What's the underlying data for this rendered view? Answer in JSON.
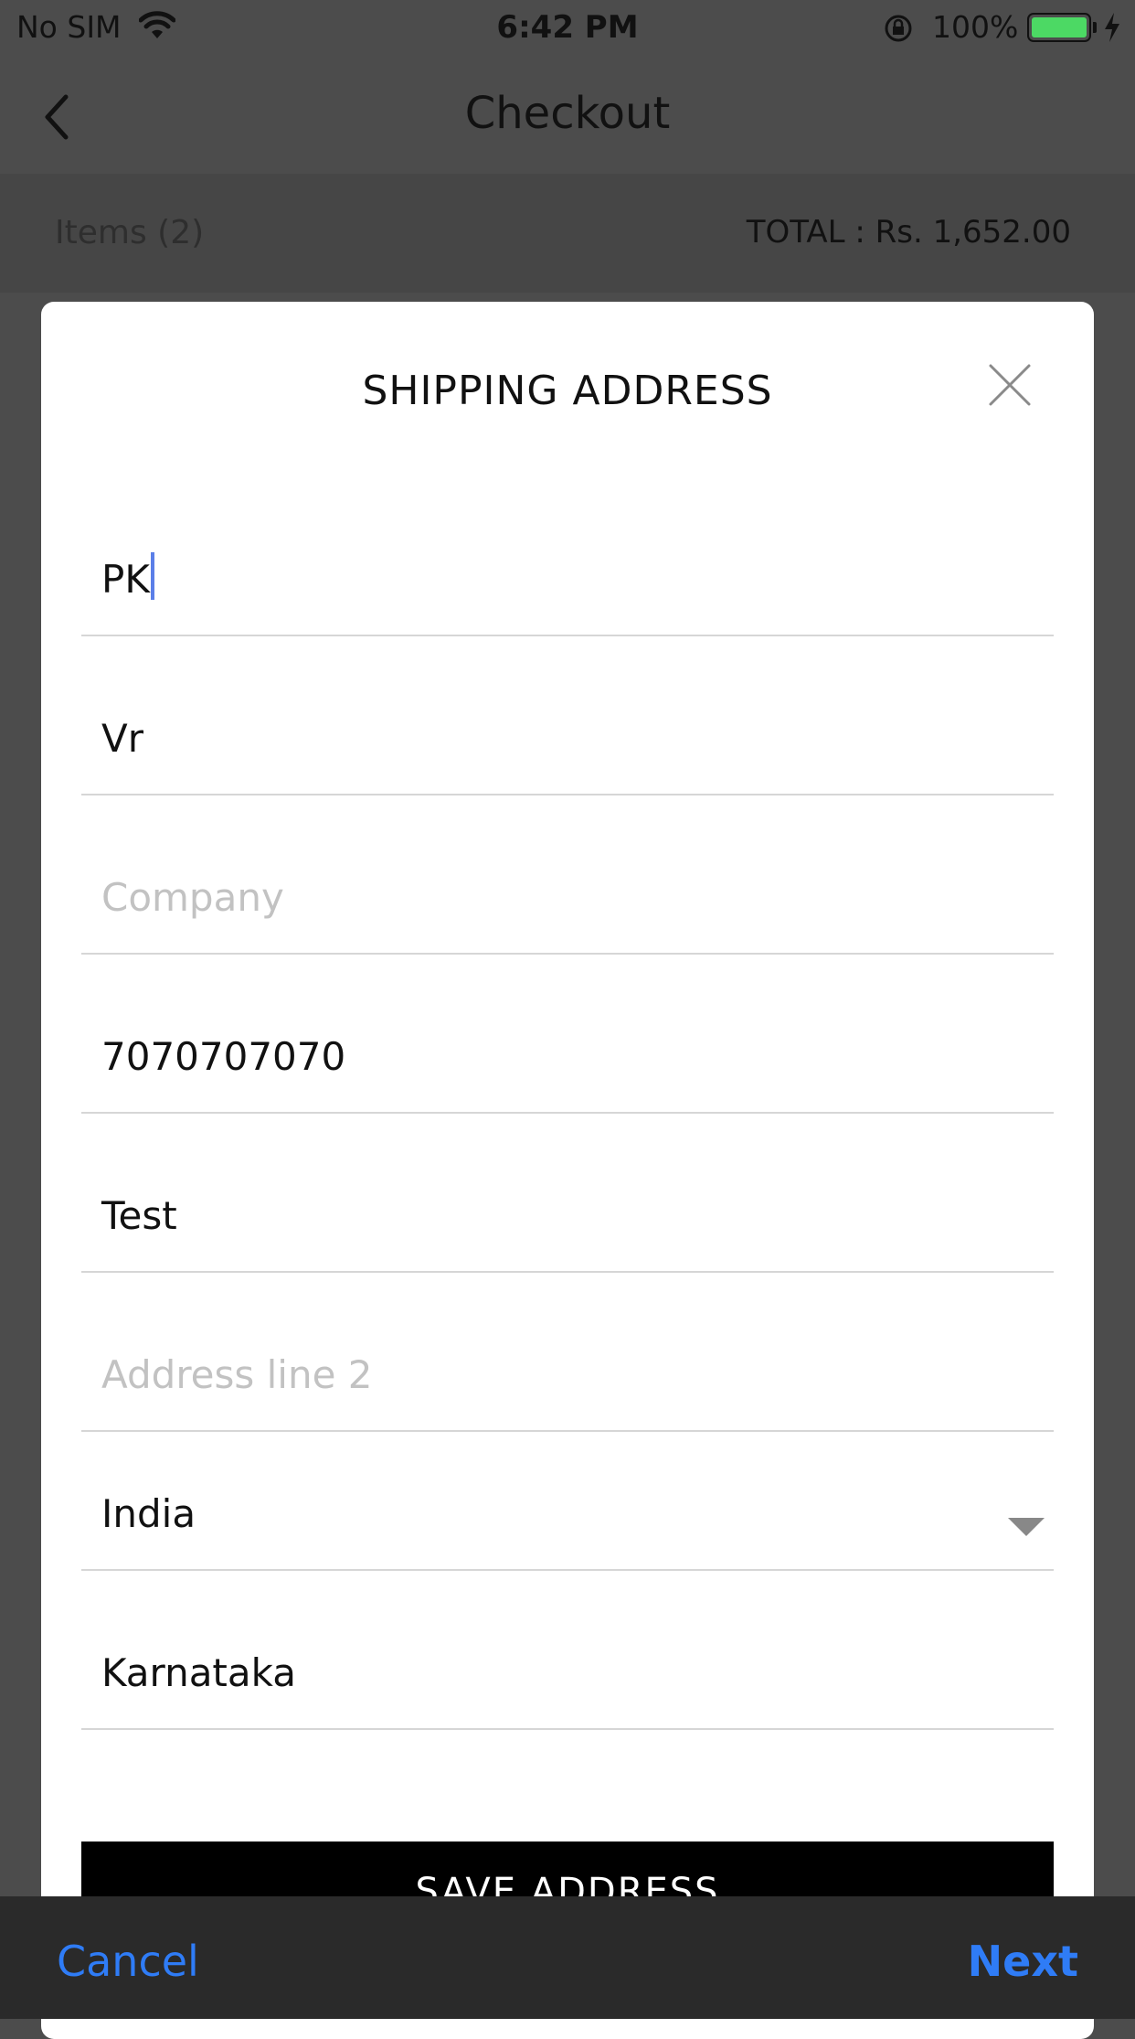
{
  "status_bar": {
    "carrier": "No SIM",
    "time": "6:42 PM",
    "battery_percent": "100%",
    "icons": [
      "wifi-icon",
      "rotation-lock-icon",
      "battery-icon",
      "charging-bolt-icon"
    ]
  },
  "nav": {
    "title": "Checkout",
    "back_icon": "chevron-left-icon"
  },
  "summary": {
    "items_label": "Items (2)",
    "total_label": "TOTAL : Rs. 1,652.00"
  },
  "modal": {
    "title": "SHIPPING ADDRESS",
    "close_icon": "close-icon",
    "fields": {
      "first_name": {
        "value": "PK"
      },
      "last_name": {
        "value": "Vr"
      },
      "company": {
        "value": "",
        "placeholder": "Company"
      },
      "phone": {
        "value": "7070707070"
      },
      "address1": {
        "value": "Test"
      },
      "address2": {
        "value": "",
        "placeholder": "Address line 2"
      },
      "country": {
        "value": "India",
        "icon": "dropdown-arrow-icon"
      },
      "state": {
        "value": "Karnataka"
      }
    },
    "save_label": "SAVE ADDRESS"
  },
  "toolbar": {
    "cancel_label": "Cancel",
    "next_label": "Next"
  },
  "colors": {
    "overlay": "#4c4c4c",
    "accent": "#2f7cf6",
    "battery": "#4cd964",
    "caret": "#5b7fe8"
  }
}
